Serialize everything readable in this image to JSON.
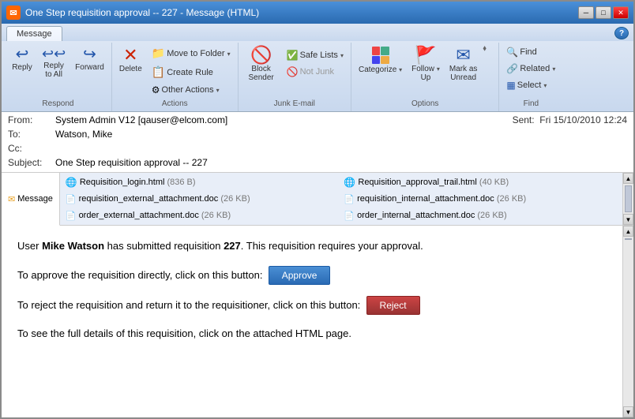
{
  "window": {
    "title": "One Step requisition approval -- 227 - Message (HTML)",
    "icon": "✉"
  },
  "titlebar": {
    "minimize": "─",
    "maximize": "□",
    "close": "✕"
  },
  "tabs": [
    {
      "label": "Message",
      "active": true
    }
  ],
  "ribbon": {
    "groups": [
      {
        "label": "Respond",
        "buttons": [
          {
            "id": "reply",
            "label": "Reply",
            "icon": "↩"
          },
          {
            "id": "reply-all",
            "label": "Reply to All",
            "icon": "↩↩"
          },
          {
            "id": "forward",
            "label": "Forward",
            "icon": "↪"
          }
        ]
      },
      {
        "label": "Actions",
        "buttons": [
          {
            "id": "delete",
            "label": "Delete",
            "icon": "✕"
          },
          {
            "id": "move-to-folder",
            "label": "Move to Folder ▾",
            "icon": "📁"
          },
          {
            "id": "create-rule",
            "label": "Create Rule",
            "icon": "📋"
          },
          {
            "id": "other-actions",
            "label": "Other Actions ▾",
            "icon": "⚙"
          }
        ]
      },
      {
        "label": "Junk E-mail",
        "buttons": [
          {
            "id": "block-sender",
            "label": "Block Sender",
            "icon": "🚫"
          },
          {
            "id": "not-junk",
            "label": "Not Junk",
            "icon": "✓"
          }
        ]
      },
      {
        "label": "Options",
        "buttons": [
          {
            "id": "categorize",
            "label": "Categorize ▾",
            "icon": "🏷"
          },
          {
            "id": "follow-up",
            "label": "Follow Up ▾",
            "icon": "🚩"
          },
          {
            "id": "mark-as-unread",
            "label": "Mark as Unread",
            "icon": "✉"
          }
        ]
      },
      {
        "label": "Find",
        "buttons": [
          {
            "id": "find",
            "label": "Find",
            "icon": "🔍"
          },
          {
            "id": "related",
            "label": "Related ▾",
            "icon": "🔗"
          },
          {
            "id": "select",
            "label": "Select ▾",
            "icon": "▦"
          }
        ]
      }
    ]
  },
  "email": {
    "from": "System Admin V12 [qauser@elcom.com]",
    "to": "Watson, Mike",
    "cc": "",
    "subject": "One Step requisition approval -- 227",
    "sent": "Fri 15/10/2010 12:24"
  },
  "attachments": {
    "tab_label": "Message",
    "files": [
      {
        "name": "Requisition_login.html",
        "size": "(836 B)",
        "type": "html"
      },
      {
        "name": "Requisition_approval_trail.html",
        "size": "(40 KB)",
        "type": "html"
      },
      {
        "name": "requisition_external_attachment.doc",
        "size": "(26 KB)",
        "type": "doc"
      },
      {
        "name": "requisition_internal_attachment.doc",
        "size": "(26 KB)",
        "type": "doc"
      },
      {
        "name": "order_external_attachment.doc",
        "size": "(26 KB)",
        "type": "doc"
      },
      {
        "name": "order_internal_attachment.doc",
        "size": "(26 KB)",
        "type": "doc"
      }
    ]
  },
  "body": {
    "line1_pre": "User ",
    "line1_bold": "Mike Watson",
    "line1_mid": " has submitted requisition ",
    "line1_num": "227",
    "line1_post": ". This requisition requires your approval.",
    "line2_pre": "To approve the requisition directly, click on this button:",
    "approve_label": "Approve",
    "line3_pre": "To reject the requisition and return it to the requisitioner, click on this button:",
    "reject_label": "Reject",
    "line4": "To see the full details of this requisition, click on the attached HTML page."
  },
  "colors": {
    "approve_bg": "#3a7fd0",
    "reject_bg": "#cc3333",
    "ribbon_bg": "#dce6f4"
  }
}
